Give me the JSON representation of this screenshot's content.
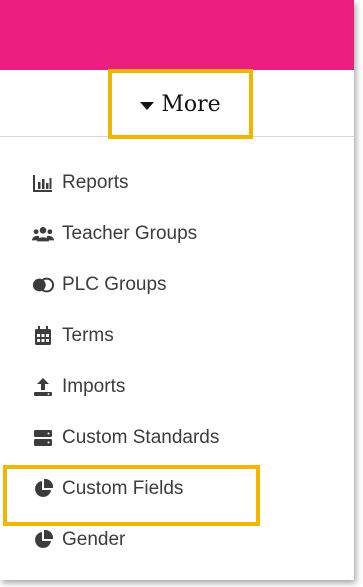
{
  "colors": {
    "banner": "#e91e7e",
    "highlight": "#f2b600",
    "text": "#3c3c3c"
  },
  "more_button": {
    "label": "More",
    "icon": "caret-down-icon"
  },
  "menu": {
    "items": [
      {
        "label": "Reports",
        "icon": "bar-chart-icon"
      },
      {
        "label": "Teacher Groups",
        "icon": "users-icon"
      },
      {
        "label": "PLC Groups",
        "icon": "overlapping-circles-icon"
      },
      {
        "label": "Terms",
        "icon": "calendar-icon"
      },
      {
        "label": "Imports",
        "icon": "upload-icon"
      },
      {
        "label": "Custom Standards",
        "icon": "server-icon"
      },
      {
        "label": "Custom Fields",
        "icon": "pie-chart-icon",
        "highlighted": true
      },
      {
        "label": "Gender",
        "icon": "pie-chart-icon"
      }
    ]
  }
}
